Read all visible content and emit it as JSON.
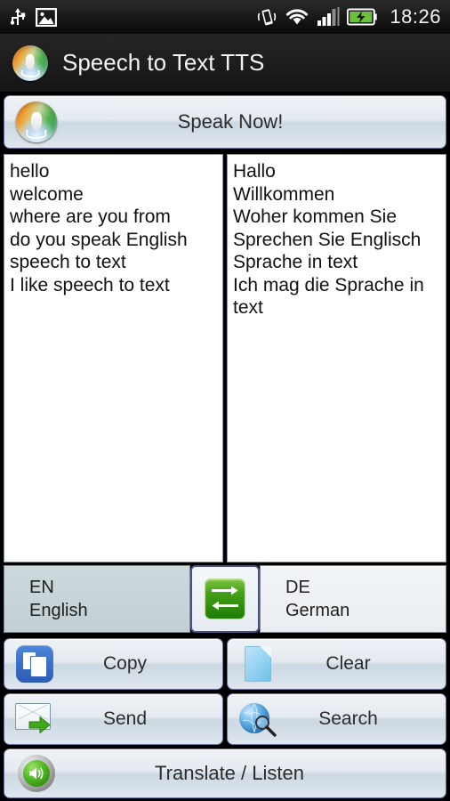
{
  "statusbar": {
    "time": "18:26",
    "icons_left": [
      "usb-icon",
      "gallery-image-icon"
    ],
    "icons_right": [
      "vibrate-icon",
      "wifi-icon",
      "signal-bars-icon",
      "battery-charging-icon"
    ]
  },
  "titlebar": {
    "app_name": "Speech to Text TTS",
    "icon": "microphone-icon"
  },
  "speak": {
    "label": "Speak Now!",
    "icon": "microphone-icon"
  },
  "panes": {
    "source_text": "hello\nwelcome\nwhere are you from\ndo you speak English\nspeech to text\nI like speech to text",
    "target_text": "Hallo\nWillkommen\nWoher kommen Sie\nSprechen Sie Englisch\nSprache in text\nIch mag die Sprache in text"
  },
  "languages": {
    "source_code": "EN",
    "source_name": "English",
    "target_code": "DE",
    "target_name": "German",
    "swap_icon": "swap-arrows-icon"
  },
  "actions": {
    "copy": {
      "label": "Copy",
      "icon": "copy-icon"
    },
    "clear": {
      "label": "Clear",
      "icon": "document-icon"
    },
    "send": {
      "label": "Send",
      "icon": "mail-send-icon"
    },
    "search": {
      "label": "Search",
      "icon": "globe-search-icon"
    },
    "translate": {
      "label": "Translate / Listen",
      "icon": "speaker-icon"
    }
  },
  "colors": {
    "accent_green": "#46a017",
    "button_face": "#e4eaf0",
    "source_lang_bg": "#c6d4d8",
    "status_bar": "#1a1a1a"
  }
}
